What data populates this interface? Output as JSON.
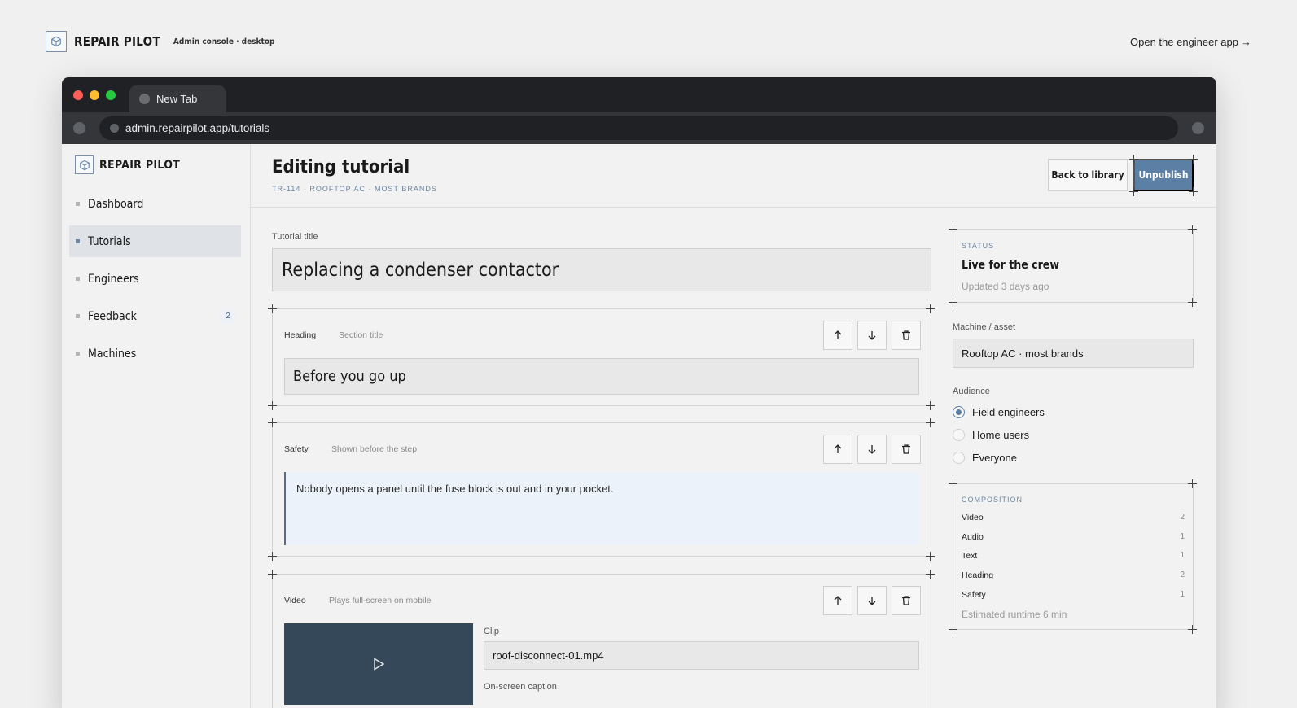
{
  "site": {
    "brand": "REPAIR PILOT",
    "subtitle": "Admin console · desktop",
    "engineer_link": "Open the engineer app",
    "engineer_link_arrow": "→"
  },
  "browser": {
    "tab_title": "New Tab",
    "url": "admin.repairpilot.app/tutorials",
    "traffic_lights": [
      "#ff5f57",
      "#febc2e",
      "#28c840"
    ]
  },
  "sidebar": {
    "brand": "REPAIR PILOT",
    "items": [
      {
        "label": "Dashboard",
        "active": false,
        "badge": ""
      },
      {
        "label": "Tutorials",
        "active": true,
        "badge": ""
      },
      {
        "label": "Engineers",
        "active": false,
        "badge": ""
      },
      {
        "label": "Feedback",
        "active": false,
        "badge": "2"
      },
      {
        "label": "Machines",
        "active": false,
        "badge": ""
      }
    ]
  },
  "header": {
    "title": "Editing tutorial",
    "subtitle": "TR-114 · ROOFTOP AC · MOST BRANDS",
    "back_label": "Back to library",
    "unpublish_label": "Unpublish"
  },
  "editor": {
    "title_label": "Tutorial title",
    "title_value": "Replacing a condenser contactor",
    "blocks": [
      {
        "type": "Heading",
        "hint": "Section title",
        "value": "Before you go up"
      },
      {
        "type": "Safety",
        "hint": "Shown before the step",
        "value": "Nobody opens a panel until the fuse block is out and in your pocket."
      },
      {
        "type": "Video",
        "hint": "Plays full-screen on mobile",
        "clip_label": "Clip",
        "clip_value": "roof-disconnect-01.mp4",
        "caption_label": "On-screen caption"
      }
    ]
  },
  "status": {
    "eyebrow": "STATUS",
    "title": "Live for the crew",
    "updated": "Updated 3 days ago"
  },
  "machine": {
    "label": "Machine / asset",
    "value": "Rooftop AC · most brands"
  },
  "audience": {
    "label": "Audience",
    "options": [
      {
        "label": "Field engineers",
        "selected": true
      },
      {
        "label": "Home users",
        "selected": false
      },
      {
        "label": "Everyone",
        "selected": false
      }
    ]
  },
  "composition": {
    "eyebrow": "COMPOSITION",
    "rows": [
      {
        "label": "Video",
        "count": "2"
      },
      {
        "label": "Audio",
        "count": "1"
      },
      {
        "label": "Text",
        "count": "1"
      },
      {
        "label": "Heading",
        "count": "2"
      },
      {
        "label": "Safety",
        "count": "1"
      }
    ],
    "runtime": "Estimated runtime 6 min"
  },
  "colors": {
    "accent": "#5c7fa6",
    "safety_bg": "#ebf2fa",
    "video_bg": "#35485a"
  }
}
